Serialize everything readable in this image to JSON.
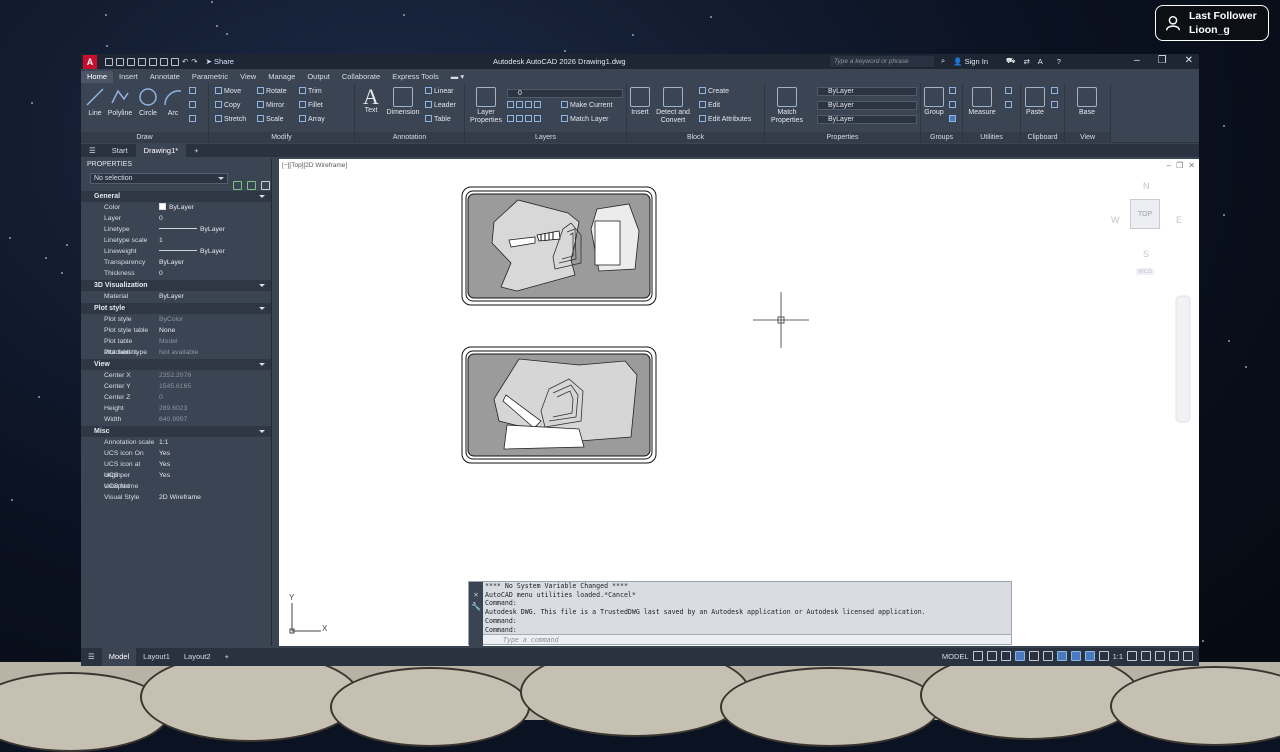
{
  "overlay": {
    "follower_title": "Last Follower",
    "follower_name": "Lioon_g"
  },
  "titlebar": {
    "app_title": "Autodesk AutoCAD 2026   Drawing1.dwg",
    "share_label": "Share",
    "search_placeholder": "Type a keyword or phrase",
    "sign_in": "Sign In"
  },
  "tabs": [
    "Home",
    "Insert",
    "Annotate",
    "Parametric",
    "View",
    "Manage",
    "Output",
    "Collaborate",
    "Express Tools"
  ],
  "ribbon": {
    "draw": {
      "title": "Draw",
      "line": "Line",
      "polyline": "Polyline",
      "circle": "Circle",
      "arc": "Arc"
    },
    "modify": {
      "title": "Modify",
      "move": "Move",
      "rotate": "Rotate",
      "trim": "Trim",
      "copy": "Copy",
      "mirror": "Mirror",
      "fillet": "Fillet",
      "stretch": "Stretch",
      "scale": "Scale",
      "array": "Array"
    },
    "annotation": {
      "title": "Annotation",
      "text": "Text",
      "dimension": "Dimension",
      "linear": "Linear",
      "leader": "Leader",
      "table": "Table"
    },
    "layers": {
      "title": "Layers",
      "layer_properties": "Layer Properties",
      "make_current": "Make Current",
      "match_layer": "Match Layer",
      "current_layer": "0"
    },
    "block": {
      "title": "Block",
      "insert": "Insert",
      "detect_convert": "Detect and Convert",
      "create": "Create",
      "edit": "Edit",
      "edit_attributes": "Edit Attributes"
    },
    "properties": {
      "title": "Properties",
      "match_properties": "Match Properties",
      "bylayer1": "ByLayer",
      "bylayer2": "ByLayer",
      "bylayer3": "ByLayer"
    },
    "groups": {
      "title": "Groups",
      "group": "Group"
    },
    "utilities": {
      "title": "Utilities",
      "measure": "Measure"
    },
    "clipboard": {
      "title": "Clipboard",
      "paste": "Paste"
    },
    "view": {
      "title": "View",
      "base": "Base"
    }
  },
  "doc_tabs": {
    "start": "Start",
    "drawing": "Drawing1*"
  },
  "properties_panel": {
    "title": "PROPERTIES",
    "selection": "No selection",
    "general": {
      "title": "General",
      "rows": [
        [
          "Color",
          "ByLayer"
        ],
        [
          "Layer",
          "0"
        ],
        [
          "Linetype",
          "ByLayer"
        ],
        [
          "Linetype scale",
          "1"
        ],
        [
          "Lineweight",
          "ByLayer"
        ],
        [
          "Transparency",
          "ByLayer"
        ],
        [
          "Thickness",
          "0"
        ]
      ]
    },
    "viz": {
      "title": "3D Visualization",
      "rows": [
        [
          "Material",
          "ByLayer"
        ]
      ]
    },
    "plot": {
      "title": "Plot style",
      "rows": [
        [
          "Plot style",
          "ByColor"
        ],
        [
          "Plot style table",
          "None"
        ],
        [
          "Plot table attached to",
          "Model"
        ],
        [
          "Plot table type",
          "Not available"
        ]
      ]
    },
    "view": {
      "title": "View",
      "rows": [
        [
          "Center X",
          "2352.2078"
        ],
        [
          "Center Y",
          "1545.6165"
        ],
        [
          "Center Z",
          "0"
        ],
        [
          "Height",
          "289.6023"
        ],
        [
          "Width",
          "640.9997"
        ]
      ]
    },
    "misc": {
      "title": "Misc",
      "rows": [
        [
          "Annotation scale",
          "1:1"
        ],
        [
          "UCS icon On",
          "Yes"
        ],
        [
          "UCS icon at origin",
          "Yes"
        ],
        [
          "UCS per viewport",
          "Yes"
        ],
        [
          "UCS Name",
          ""
        ],
        [
          "Visual Style",
          "2D Wireframe"
        ]
      ]
    }
  },
  "canvas": {
    "viewport_label": "[−][Top][2D Wireframe]",
    "viewcube": {
      "top": "TOP",
      "n": "N",
      "s": "S",
      "e": "E",
      "w": "W",
      "wcs": "WCS"
    },
    "ucs": {
      "x": "X",
      "y": "Y"
    }
  },
  "command": {
    "lines": [
      "**** No System Variable Changed ****",
      "AutoCAD menu utilities loaded.*Cancel*",
      "Command:",
      "Autodesk DWG.  This file is a TrustedDWG last saved by an Autodesk application or Autodesk licensed application.",
      "Command:",
      "Command:"
    ],
    "placeholder": "Type a command"
  },
  "statusbar": {
    "model": "Model",
    "layout1": "Layout1",
    "layout2": "Layout2",
    "model_space": "MODEL",
    "scale": "1:1"
  }
}
